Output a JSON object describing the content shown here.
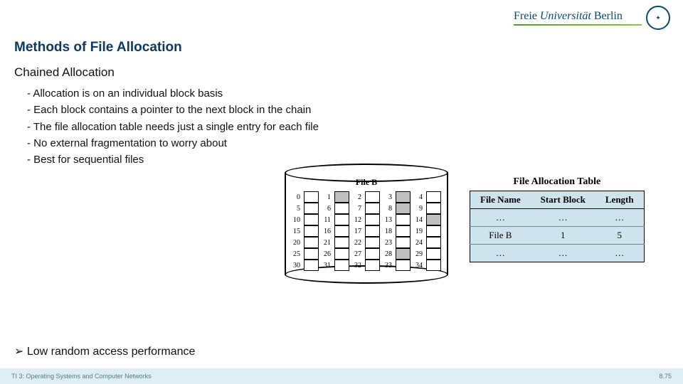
{
  "header": {
    "logo_left": "Freie",
    "logo_mid": "Universität",
    "logo_right": "Berlin"
  },
  "title": "Methods of File Allocation",
  "section": "Chained Allocation",
  "bullets": [
    "- Allocation is on an individual block basis",
    "- Each block contains a pointer to the next block in the chain",
    "- The file allocation table needs just a single entry for each file",
    "- No external fragmentation to worry about",
    "- Best for sequential files"
  ],
  "conclusion": "➢ Low random access performance",
  "footer": {
    "left": "TI 3: Operating Systems and Computer Networks",
    "right": "8.75"
  },
  "diagram": {
    "file_label": "File B",
    "rows": [
      {
        "start": "0",
        "filled": [
          1,
          3
        ]
      },
      {
        "start": "5",
        "filled": [
          8
        ]
      },
      {
        "start": "10",
        "filled": [
          14
        ]
      },
      {
        "start": "15",
        "filled": []
      },
      {
        "start": "20",
        "filled": []
      },
      {
        "start": "25",
        "filled": [
          28
        ]
      },
      {
        "start": "30",
        "filled": []
      }
    ],
    "cols": 5
  },
  "fat": {
    "title": "File Allocation Table",
    "headers": [
      "File Name",
      "Start Block",
      "Length"
    ],
    "rows": [
      [
        "…",
        "…",
        "…"
      ],
      [
        "File B",
        "1",
        "5"
      ],
      [
        "…",
        "…",
        "…"
      ]
    ]
  }
}
